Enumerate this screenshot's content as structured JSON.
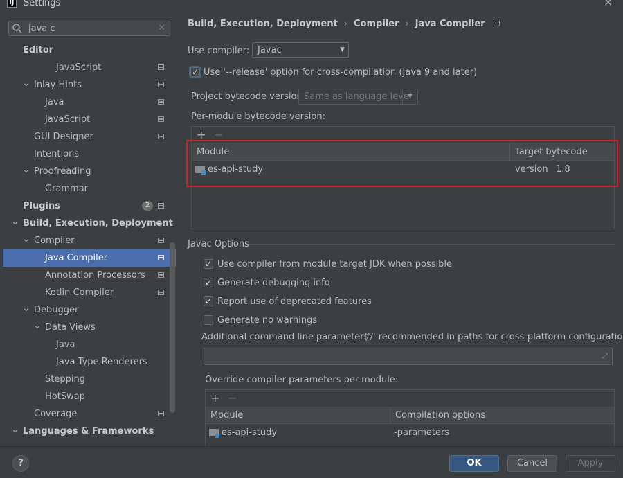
{
  "window": {
    "title": "Settings",
    "app_icon": "IJ"
  },
  "search": {
    "value": "java c",
    "placeholder": ""
  },
  "tree": [
    {
      "label": "Editor",
      "level": 0,
      "bold": true,
      "chevron": "",
      "page_icon": false
    },
    {
      "label": "JavaScript",
      "level": 3,
      "chevron": "",
      "page_icon": true
    },
    {
      "label": "Inlay Hints",
      "level": 1,
      "chevron": "v",
      "page_icon": true
    },
    {
      "label": "Java",
      "level": 2,
      "chevron": "",
      "page_icon": true
    },
    {
      "label": "JavaScript",
      "level": 2,
      "chevron": "",
      "page_icon": true
    },
    {
      "label": "GUI Designer",
      "level": 1,
      "chevron": "",
      "page_icon": true
    },
    {
      "label": "Intentions",
      "level": 1,
      "chevron": "",
      "page_icon": false
    },
    {
      "label": "Proofreading",
      "level": 1,
      "chevron": "v",
      "page_icon": false
    },
    {
      "label": "Grammar",
      "level": 2,
      "chevron": "",
      "page_icon": false
    },
    {
      "label": "Plugins",
      "level": 0,
      "bold": true,
      "chevron": "",
      "page_icon": true,
      "badge": "2"
    },
    {
      "label": "Build, Execution, Deployment",
      "level": 0,
      "bold": true,
      "chevron": "v",
      "page_icon": false
    },
    {
      "label": "Compiler",
      "level": 1,
      "chevron": "v",
      "page_icon": true
    },
    {
      "label": "Java Compiler",
      "level": 2,
      "chevron": "",
      "page_icon": true,
      "selected": true
    },
    {
      "label": "Annotation Processors",
      "level": 2,
      "chevron": "",
      "page_icon": true
    },
    {
      "label": "Kotlin Compiler",
      "level": 2,
      "chevron": "",
      "page_icon": true
    },
    {
      "label": "Debugger",
      "level": 1,
      "chevron": "v",
      "page_icon": false
    },
    {
      "label": "Data Views",
      "level": 2,
      "chevron": "v",
      "page_icon": false
    },
    {
      "label": "Java",
      "level": 3,
      "chevron": "",
      "page_icon": false
    },
    {
      "label": "Java Type Renderers",
      "level": 3,
      "chevron": "",
      "page_icon": false
    },
    {
      "label": "Stepping",
      "level": 2,
      "chevron": "",
      "page_icon": false
    },
    {
      "label": "HotSwap",
      "level": 2,
      "chevron": "",
      "page_icon": false
    },
    {
      "label": "Coverage",
      "level": 1,
      "chevron": "",
      "page_icon": true
    },
    {
      "label": "Languages & Frameworks",
      "level": 0,
      "bold": true,
      "chevron": "v",
      "page_icon": false
    }
  ],
  "breadcrumb": [
    "Build, Execution, Deployment",
    "Compiler",
    "Java Compiler"
  ],
  "compiler": {
    "use_compiler_label": "Use compiler:",
    "use_compiler_value": "Javac",
    "release_option_label": "Use '--release' option for cross-compilation (Java 9 and later)",
    "release_option_checked": true,
    "project_bytecode_label": "Project bytecode version:",
    "project_bytecode_value": "Same as language level",
    "per_module_label": "Per-module bytecode version:",
    "add_symbol": "+",
    "remove_symbol": "−",
    "module_table": {
      "headers": [
        "Module",
        "Target bytecode version"
      ],
      "rows": [
        {
          "module": "es-api-study",
          "version": "1.8"
        }
      ]
    }
  },
  "javac": {
    "section_title": "Javac Options",
    "options": [
      {
        "label": "Use compiler from module target JDK when possible",
        "checked": true
      },
      {
        "label": "Generate debugging info",
        "checked": true
      },
      {
        "label": "Report use of deprecated features",
        "checked": true
      },
      {
        "label": "Generate no warnings",
        "checked": false
      }
    ],
    "additional_params_label": "Additional command line parameters:",
    "additional_params_hint": "('/' recommended in paths for cross-platform configurations)",
    "additional_params_value": "",
    "override_label": "Override compiler parameters per-module:",
    "override_table": {
      "headers": [
        "Module",
        "Compilation options"
      ],
      "rows": [
        {
          "module": "es-api-study",
          "options": "-parameters"
        }
      ]
    }
  },
  "footer": {
    "help": "?",
    "ok": "OK",
    "cancel": "Cancel",
    "apply": "Apply"
  },
  "colors": {
    "selection": "#4b6eaf",
    "primary_button": "#365880",
    "highlight_border": "#d71f2b",
    "background": "#3c3f41"
  }
}
